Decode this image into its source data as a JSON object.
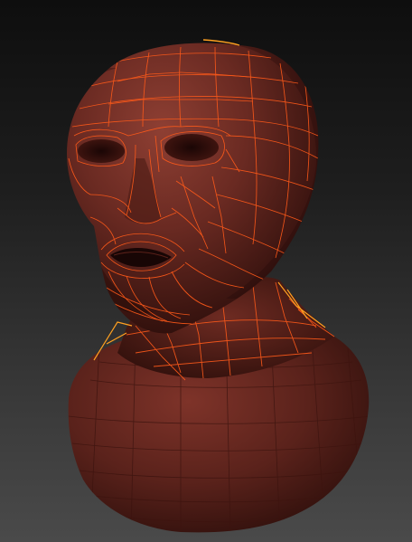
{
  "viewport": {
    "background_top": "#0e0e0e",
    "background_bottom": "#4a4a4a"
  },
  "model": {
    "base_color": "#6a2a22",
    "dark_color": "#2a0d0a",
    "highlight_color": "#8a3b30",
    "wire_color": "#ff5a1a",
    "selection_glow": "#ffa020",
    "mode": "polyframe"
  }
}
